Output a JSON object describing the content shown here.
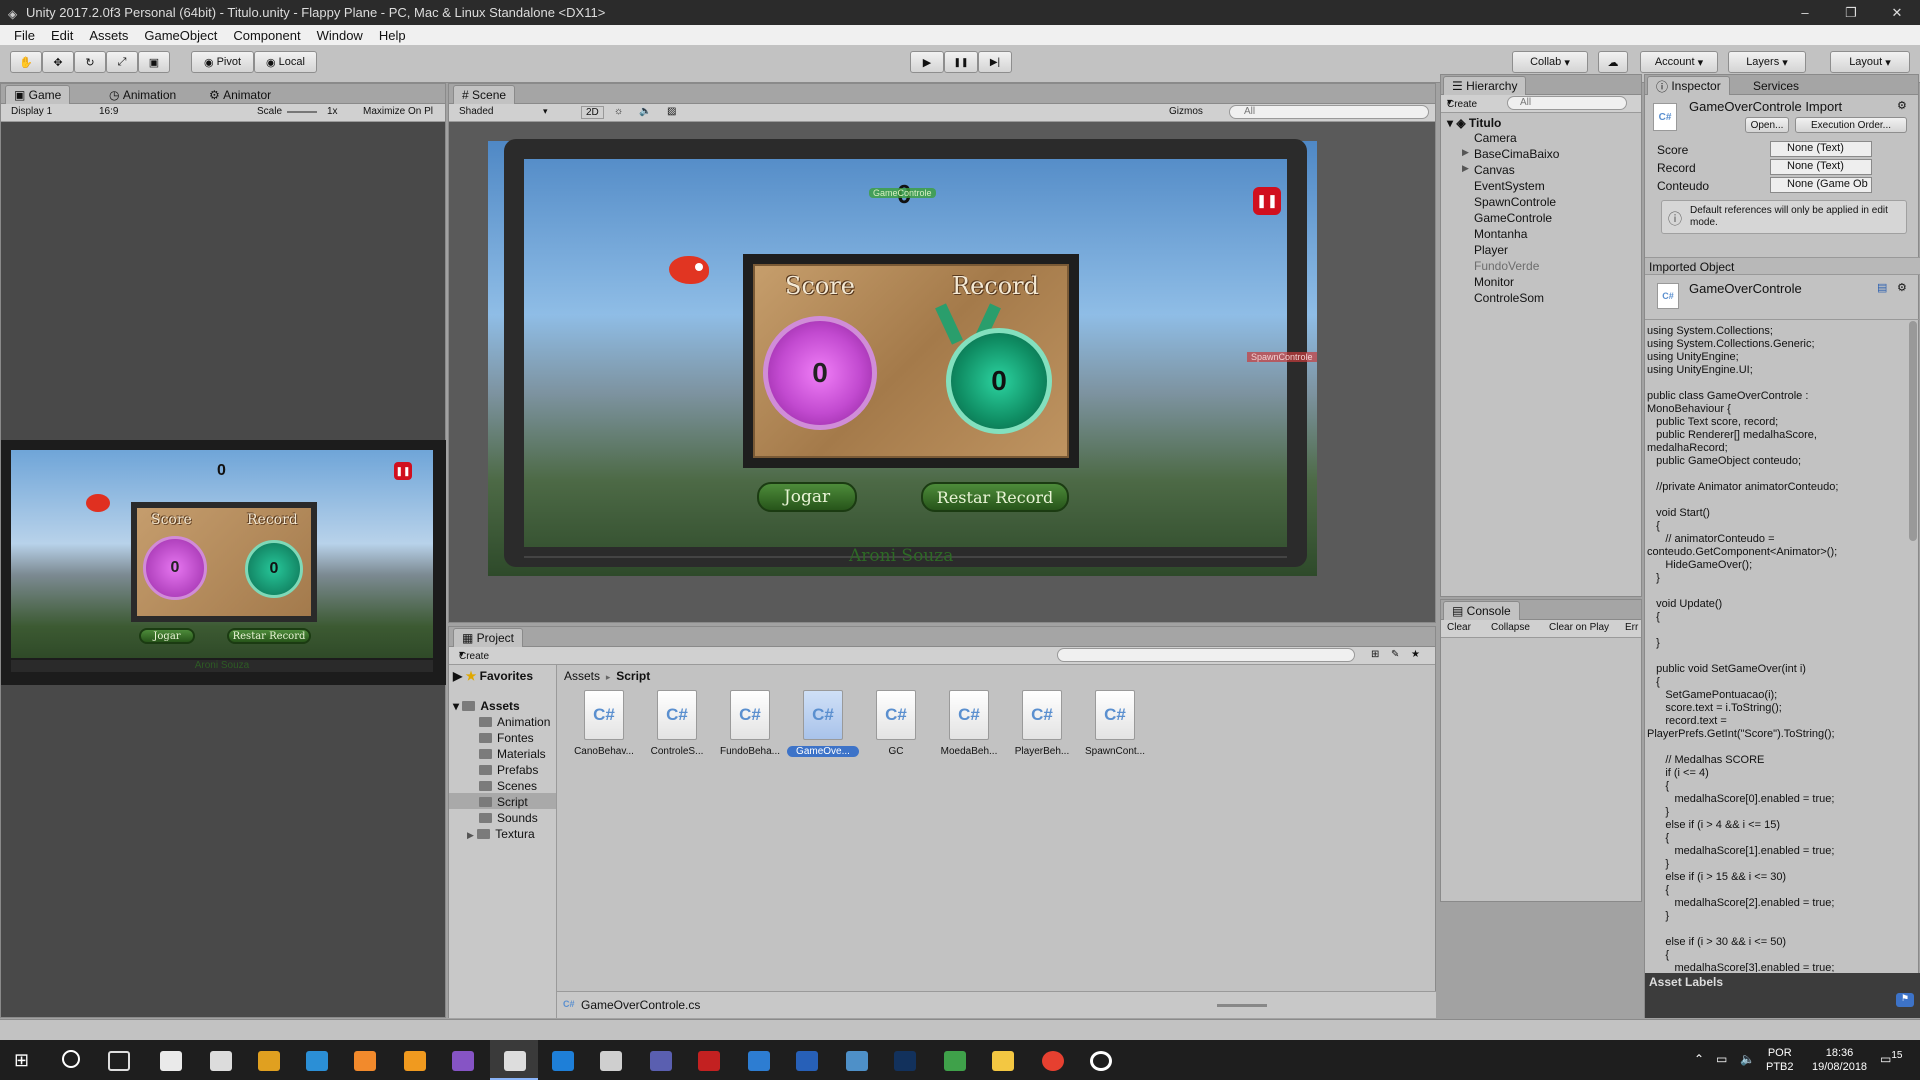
{
  "window": {
    "title": "Unity 2017.2.0f3 Personal (64bit) - Titulo.unity - Flappy Plane - PC, Mac & Linux Standalone <DX11>",
    "min": "–",
    "max": "❐",
    "close": "✕"
  },
  "menu": [
    "File",
    "Edit",
    "Assets",
    "GameObject",
    "Component",
    "Window",
    "Help"
  ],
  "toolbar": {
    "pivot": "Pivot",
    "local": "Local",
    "play": "▶",
    "pause": "❚❚",
    "step": "▶|",
    "collab": "Collab",
    "account": "Account",
    "layers": "Layers",
    "layout": "Layout"
  },
  "game_panel": {
    "tabs": [
      "Game",
      "Animation",
      "Animator"
    ],
    "display": "Display 1",
    "aspect": "16:9",
    "scale_label": "Scale",
    "scale_value": "1x",
    "maximize": "Maximize On Pl"
  },
  "scene_panel": {
    "tab": "Scene",
    "shading": "Shaded",
    "mode_2d": "2D",
    "gizmos": "Gizmos",
    "search_placeholder": "All",
    "labels": {
      "game_controle": "GameControle",
      "spawn_controle": "SpawnControle"
    }
  },
  "game_view": {
    "score_counter": "0",
    "score_title": "Score",
    "record_title": "Record",
    "score_value": "0",
    "record_value": "0",
    "btn_play": "Jogar",
    "btn_reset": "Restar Record",
    "credit": "Aroni Souza"
  },
  "hierarchy": {
    "tab": "Hierarchy",
    "create": "Create",
    "search_placeholder": "All",
    "scene": "Titulo",
    "items": [
      "Camera",
      "BaseCimaBaixo",
      "Canvas",
      "EventSystem",
      "SpawnControle",
      "GameControle",
      "Montanha",
      "Player",
      "FundoVerde",
      "Monitor",
      "ControleSom"
    ]
  },
  "console": {
    "tab": "Console",
    "buttons": [
      "Clear",
      "Collapse",
      "Clear on Play",
      "Err"
    ]
  },
  "project": {
    "tab": "Project",
    "create": "Create",
    "favorites": "Favorites",
    "breadcrumb": [
      "Assets",
      "Script"
    ],
    "root": "Assets",
    "folders": [
      "Animation",
      "Fontes",
      "Materials",
      "Prefabs",
      "Scenes",
      "Script",
      "Sounds",
      "Textura"
    ],
    "selected_folder": "Script",
    "assets": [
      "CanoBehav...",
      "ControleS...",
      "FundoBeha...",
      "GameOve...",
      "GC",
      "MoedaBeh...",
      "PlayerBeh...",
      "SpawnCont..."
    ],
    "selected_asset": "GameOve...",
    "status_file": "GameOverControle.cs"
  },
  "inspector": {
    "tabs": [
      "Inspector",
      "Services"
    ],
    "title": "GameOverControle Import",
    "open": "Open...",
    "exec_order": "Execution Order...",
    "fields": [
      {
        "label": "Score",
        "value": "None (Text)"
      },
      {
        "label": "Record",
        "value": "None (Text)"
      },
      {
        "label": "Conteudo",
        "value": "None (Game Ob"
      }
    ],
    "note": "Default references will only be applied in edit mode.",
    "imported_header": "Imported Object",
    "imported_name": "GameOverControle",
    "asset_labels": "Asset Labels",
    "code": "using System.Collections;\nusing System.Collections.Generic;\nusing UnityEngine;\nusing UnityEngine.UI;\n\npublic class GameOverControle :\nMonoBehaviour {\n   public Text score, record;\n   public Renderer[] medalhaScore,\nmedalhaRecord;\n   public GameObject conteudo;\n\n   //private Animator animatorConteudo;\n\n   void Start()\n   {\n      // animatorConteudo =\nconteudo.GetComponent<Animator>();\n      HideGameOver();\n   }\n\n   void Update()\n   {\n\n   }\n\n   public void SetGameOver(int i)\n   {\n      SetGamePontuacao(i);\n      score.text = i.ToString();\n      record.text =\nPlayerPrefs.GetInt(\"Score\").ToString();\n\n      // Medalhas SCORE\n      if (i <= 4)\n      {\n         medalhaScore[0].enabled = true;\n      }\n      else if (i > 4 && i <= 15)\n      {\n         medalhaScore[1].enabled = true;\n      }\n      else if (i > 15 && i <= 30)\n      {\n         medalhaScore[2].enabled = true;\n      }\n\n      else if (i > 30 && i <= 50)\n      {\n         medalhaScore[3].enabled = true;"
  },
  "taskbar": {
    "lang1": "POR",
    "lang2": "PTB2",
    "time": "18:36",
    "date": "19/08/2018",
    "notif": "15"
  }
}
